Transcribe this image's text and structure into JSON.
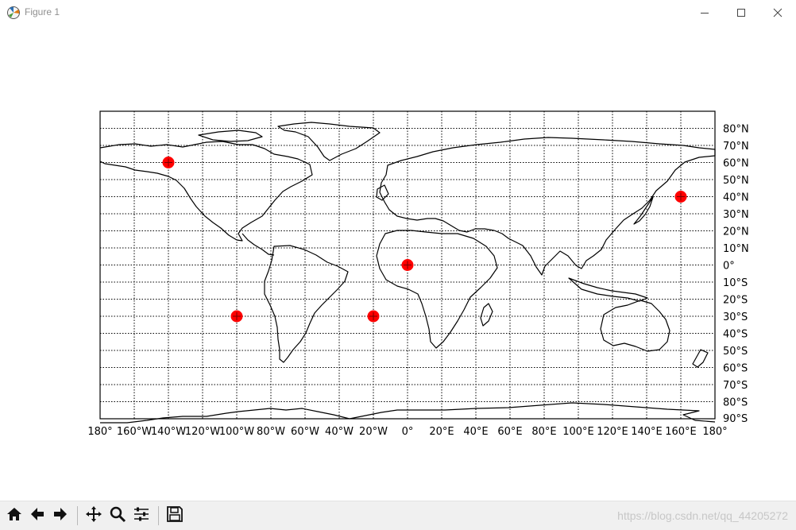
{
  "window": {
    "title": "Figure 1",
    "minimize_icon": "minimize-icon",
    "maximize_icon": "maximize-icon",
    "close_icon": "close-icon"
  },
  "chart_data": {
    "type": "scatter",
    "projection": "cylindrical",
    "xlim": [
      -180,
      180
    ],
    "ylim": [
      -90,
      90
    ],
    "grid": true,
    "x_ticks": [
      "180°",
      "160°W",
      "140°W",
      "120°W",
      "100°W",
      "80°W",
      "60°W",
      "40°W",
      "20°W",
      "0°",
      "20°E",
      "40°E",
      "60°E",
      "80°E",
      "100°E",
      "120°E",
      "140°E",
      "160°E",
      "180°"
    ],
    "y_ticks": [
      "80°N",
      "70°N",
      "60°N",
      "50°N",
      "40°N",
      "30°N",
      "20°N",
      "10°N",
      "0°",
      "10°S",
      "20°S",
      "30°S",
      "40°S",
      "50°S",
      "60°S",
      "70°S",
      "80°S",
      "90°S"
    ],
    "points": [
      {
        "lon": -140,
        "lat": 60
      },
      {
        "lon": 160,
        "lat": 40
      },
      {
        "lon": 0,
        "lat": 0
      },
      {
        "lon": -100,
        "lat": -30
      },
      {
        "lon": -20,
        "lat": -30
      }
    ],
    "marker_color": "#ff0000"
  },
  "toolbar": {
    "items": [
      "home-icon",
      "back-icon",
      "forward-icon",
      "pan-icon",
      "zoom-icon",
      "configure-subplots-icon",
      "save-icon"
    ]
  },
  "watermark": "https://blog.csdn.net/qq_44205272"
}
